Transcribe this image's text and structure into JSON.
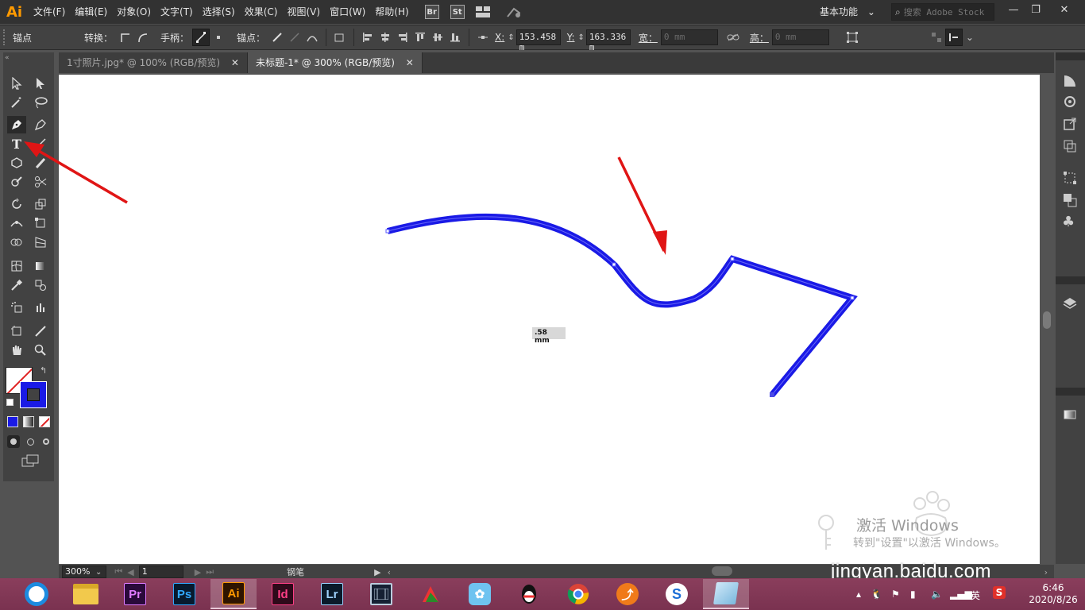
{
  "app": {
    "logo": "Ai"
  },
  "menu": [
    "文件(F)",
    "编辑(E)",
    "对象(O)",
    "文字(T)",
    "选择(S)",
    "效果(C)",
    "视图(V)",
    "窗口(W)",
    "帮助(H)"
  ],
  "app_buttons": [
    "Br",
    "St"
  ],
  "workspace": "基本功能",
  "search": {
    "placeholder": "搜索 Adobe Stock"
  },
  "control_bar": {
    "anchor_label": "锚点",
    "convert_label": "转换：",
    "handle_label": "手柄：",
    "anchor2_label": "锚点：",
    "x_label": "X:",
    "x_value": "153.458 m",
    "y_label": "Y:",
    "y_value": "163.336 m",
    "w_label": "宽：",
    "w_value": "0 mm",
    "h_label": "高：",
    "h_value": "0 mm"
  },
  "tabs": [
    {
      "label": "1寸照片.jpg* @ 100% (RGB/预览)",
      "active": false
    },
    {
      "label": "未标题-1* @ 300% (RGB/预览)",
      "active": true
    }
  ],
  "canvas": {
    "measure_tooltip": ".58 mm",
    "stroke_color": "#1a1ae6"
  },
  "status_bar": {
    "zoom": "300%",
    "artboard": "1",
    "tool_name": "钢笔"
  },
  "watermark": {
    "line1": "激活 Windows",
    "line2": "转到\"设置\"以激活 Windows。",
    "brand": "jingyan.baidu.com"
  },
  "taskbar": {
    "apps": [
      "browser",
      "explorer",
      "Pr",
      "Ps",
      "Ai",
      "Id",
      "Lr",
      "video",
      "screenshot",
      "messenger",
      "qq",
      "chrome",
      "media",
      "sogou",
      "viewer"
    ],
    "time": "6:46",
    "date": "2020/8/26",
    "ime": "英"
  }
}
